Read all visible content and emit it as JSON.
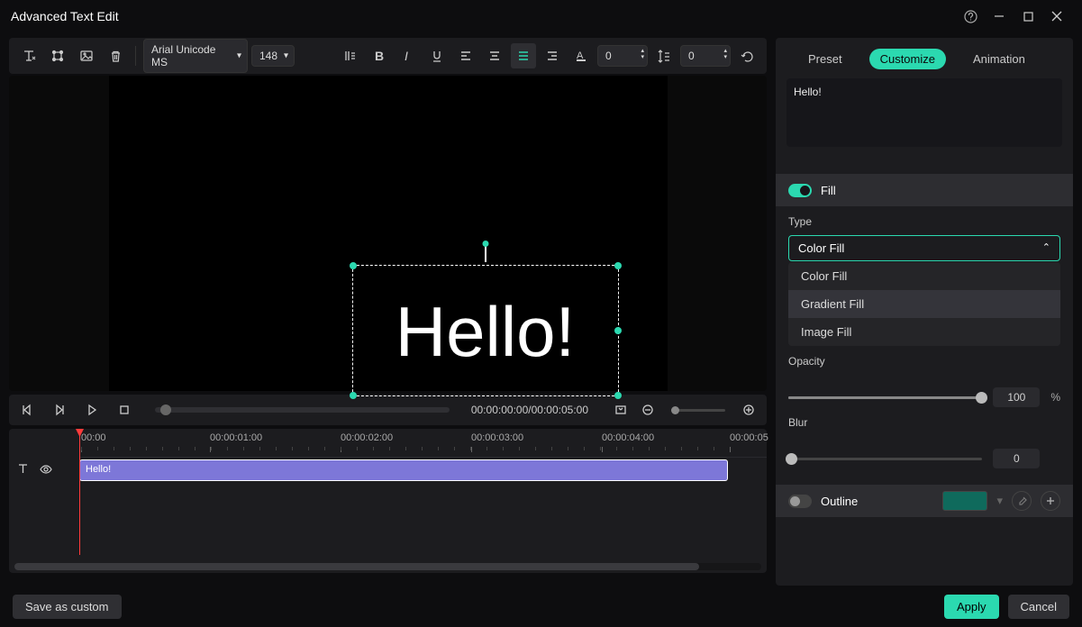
{
  "title": "Advanced Text Edit",
  "toolbar": {
    "font": "Arial Unicode MS",
    "size": "148",
    "spacing1": "0",
    "spacing2": "0"
  },
  "canvas": {
    "text": "Hello!"
  },
  "playback": {
    "time": "00:00:00:00/00:00:05:00"
  },
  "timeline": {
    "ticks": [
      "00:00",
      "00:00:01:00",
      "00:00:02:00",
      "00:00:03:00",
      "00:00:04:00",
      "00:00:05"
    ],
    "clip_label": "Hello!"
  },
  "panel": {
    "tabs": {
      "preset": "Preset",
      "customize": "Customize",
      "animation": "Animation"
    },
    "text_value": "Hello!",
    "fill_label": "Fill",
    "type_label": "Type",
    "type_value": "Color Fill",
    "type_options": [
      "Color Fill",
      "Gradient Fill",
      "Image Fill"
    ],
    "opacity_label": "Opacity",
    "opacity_value": "100",
    "opacity_unit": "%",
    "blur_label": "Blur",
    "blur_value": "0",
    "outline_label": "Outline"
  },
  "footer": {
    "save_custom": "Save as custom",
    "apply": "Apply",
    "cancel": "Cancel"
  }
}
